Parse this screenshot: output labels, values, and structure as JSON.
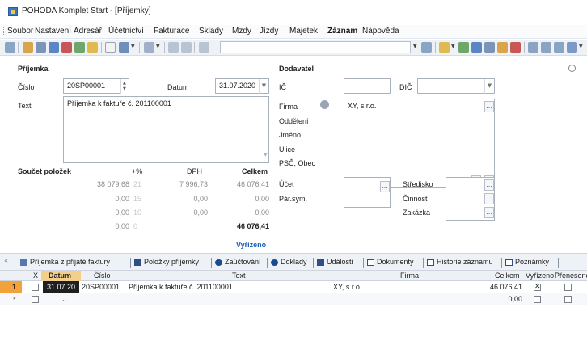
{
  "window": {
    "title": "POHODA Komplet Start - [Příjemky]"
  },
  "menu": [
    "Soubor",
    "Nastavení",
    "Adresář",
    "Účetnictví",
    "Fakturace",
    "Sklady",
    "Mzdy",
    "Jízdy",
    "Majetek",
    "Záznam",
    "Nápověda"
  ],
  "colors": {
    "accent": "#1c5fb8",
    "selected_cell": "#1f1f1f",
    "row_marker": "#f3a23a"
  },
  "form": {
    "section_prijemka": "Příjemka",
    "cislo_label": "Číslo",
    "cislo_value": "20SP00001",
    "datum_label": "Datum",
    "datum_value": "31.07.2020",
    "text_label": "Text",
    "text_value": "Příjemka k faktuře č. 201100001",
    "section_dodavatel": "Dodavatel",
    "ic_label": "IČ",
    "dic_label": "DIČ",
    "firma_label": "Firma",
    "firma_value": "XY, s.r.o.",
    "oddeleni_label": "Oddělení",
    "jmeno_label": "Jméno",
    "ulice_label": "Ulice",
    "psc_label": "PSČ, Obec",
    "ucet_label": "Účet",
    "parsym_label": "Pár.sym.",
    "stredisko_label": "Středisko",
    "cinnost_label": "Činnost",
    "zakazka_label": "Zakázka",
    "status": "Vyřízeno"
  },
  "totals": {
    "title": "Součet položek",
    "col_pct": "+%",
    "col_dph": "DPH",
    "col_celkem": "Celkem",
    "rows": [
      {
        "base": "38 079,68",
        "pct": "21",
        "dph": "7 996,73",
        "celkem": "46 076,41"
      },
      {
        "base": "0,00",
        "pct": "15",
        "dph": "0,00",
        "celkem": "0,00"
      },
      {
        "base": "0,00",
        "pct": "10",
        "dph": "0,00",
        "celkem": "0,00"
      },
      {
        "base": "0,00",
        "pct": "0",
        "dph": "",
        "celkem": "46 076,41"
      }
    ]
  },
  "tabs": [
    "Příjemka z přijaté faktury",
    "Položky příjemky",
    "Zaúčtování",
    "Doklady",
    "Události",
    "Dokumenty",
    "Historie záznamu",
    "Poznámky"
  ],
  "grid": {
    "columns": [
      "X",
      "Datum",
      "Číslo",
      "Text",
      "Firma",
      "Celkem",
      "Vyřízeno",
      "Přeneseno"
    ],
    "rows": [
      {
        "num": "1",
        "datum": "31.07.20",
        "cislo": "20SP00001",
        "text": "Příjemka k faktuře č. 201100001",
        "firma": "XY, s.r.o.",
        "celkem": "46 076,41",
        "vyrizeno": true,
        "preneseno": false
      },
      {
        "num": "*",
        "datum": "..",
        "cislo": "",
        "text": "",
        "firma": "",
        "celkem": "0,00",
        "vyrizeno": false,
        "preneseno": false
      }
    ]
  }
}
